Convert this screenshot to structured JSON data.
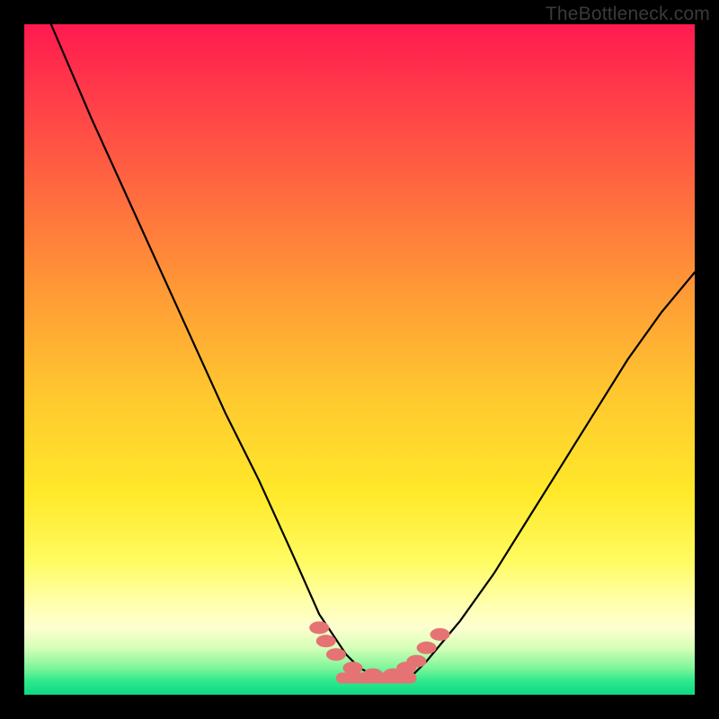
{
  "watermark": "TheBottleneck.com",
  "chart_data": {
    "type": "line",
    "title": "",
    "xlabel": "",
    "ylabel": "",
    "xlim": [
      0,
      100
    ],
    "ylim": [
      0,
      100
    ],
    "series": [
      {
        "name": "bottleneck-curve",
        "x": [
          4,
          10,
          15,
          20,
          25,
          30,
          35,
          40,
          44,
          46,
          48,
          50,
          52,
          54,
          56,
          58,
          60,
          65,
          70,
          75,
          80,
          85,
          90,
          95,
          100
        ],
        "values": [
          100,
          86,
          75,
          64,
          53,
          42,
          32,
          21,
          12,
          9,
          6,
          4,
          3,
          2,
          2,
          3,
          5,
          11,
          18,
          26,
          34,
          42,
          50,
          57,
          63
        ]
      }
    ],
    "highlight_points": {
      "name": "optimal-zone-markers",
      "color": "#e57373",
      "x": [
        44,
        45,
        46.5,
        49,
        52,
        55,
        57,
        58.5,
        60,
        62
      ],
      "values": [
        10,
        8,
        6,
        4,
        3,
        3,
        4,
        5,
        7,
        9
      ]
    }
  }
}
